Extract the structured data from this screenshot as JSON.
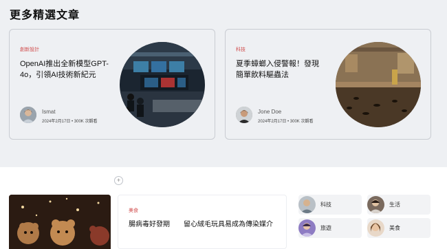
{
  "section": {
    "title": "更多精選文章"
  },
  "cards": [
    {
      "category": "創新設計",
      "title": "OpenAI推出全新模型GPT-4o，引領AI技術新紀元",
      "author": "Ismat",
      "meta": "2024年2月17日 • 300K 次觀看"
    },
    {
      "category": "科技",
      "title": "夏季蟑螂入侵警報！發現簡單飲料驅蟲法",
      "author": "Jone Doe",
      "meta": "2024年2月17日 • 300K 次觀看"
    }
  ],
  "featured": {
    "category": "美食",
    "title": "腸病毒好發期　　留心絨毛玩具易成為傳染媒介"
  },
  "mini_tags": [
    {
      "label": "科技"
    },
    {
      "label": "生活"
    },
    {
      "label": "旅遊"
    },
    {
      "label": "美食"
    }
  ],
  "icons": {
    "add": "plus-icon"
  }
}
